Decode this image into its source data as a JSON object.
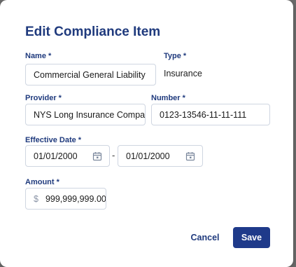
{
  "dialog": {
    "title": "Edit Compliance Item"
  },
  "fields": {
    "name": {
      "label": "Name *",
      "value": "Commercial General Liability"
    },
    "type": {
      "label": "Type *",
      "value": "Insurance"
    },
    "provider": {
      "label": "Provider *",
      "value": "NYS Long Insurance Company"
    },
    "number": {
      "label": "Number *",
      "value": "0123-13546-11-11-111"
    },
    "effective_date": {
      "label": "Effective Date *",
      "start": "01/01/2000",
      "separator": "-",
      "end": "01/01/2000"
    },
    "amount": {
      "label": "Amount *",
      "currency_symbol": "$",
      "value": "999,999,999.00"
    }
  },
  "actions": {
    "cancel_label": "Cancel",
    "save_label": "Save"
  },
  "colors": {
    "primary": "#1f3a8a",
    "label": "#1f3a7d",
    "border": "#cfd6e1",
    "icon": "#7a879c"
  },
  "icons": {
    "date_picker": "calendar-icon"
  }
}
